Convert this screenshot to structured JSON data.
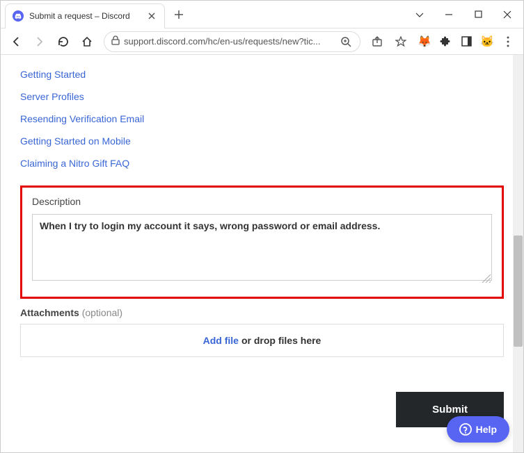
{
  "browser": {
    "tab_title": "Submit a request – Discord",
    "url_display": "support.discord.com/hc/en-us/requests/new?tic..."
  },
  "links": [
    "Getting Started",
    "Server Profiles",
    "Resending Verification Email",
    "Getting Started on Mobile",
    "Claiming a Nitro Gift FAQ"
  ],
  "form": {
    "description_label": "Description",
    "description_value": "When I try to login my account it says, wrong password or email address.",
    "attachments_label": "Attachments",
    "attachments_optional": "(optional)",
    "dropzone_addfile": "Add file",
    "dropzone_rest": "or drop files here",
    "submit_label": "Submit"
  },
  "help": {
    "label": "Help"
  }
}
